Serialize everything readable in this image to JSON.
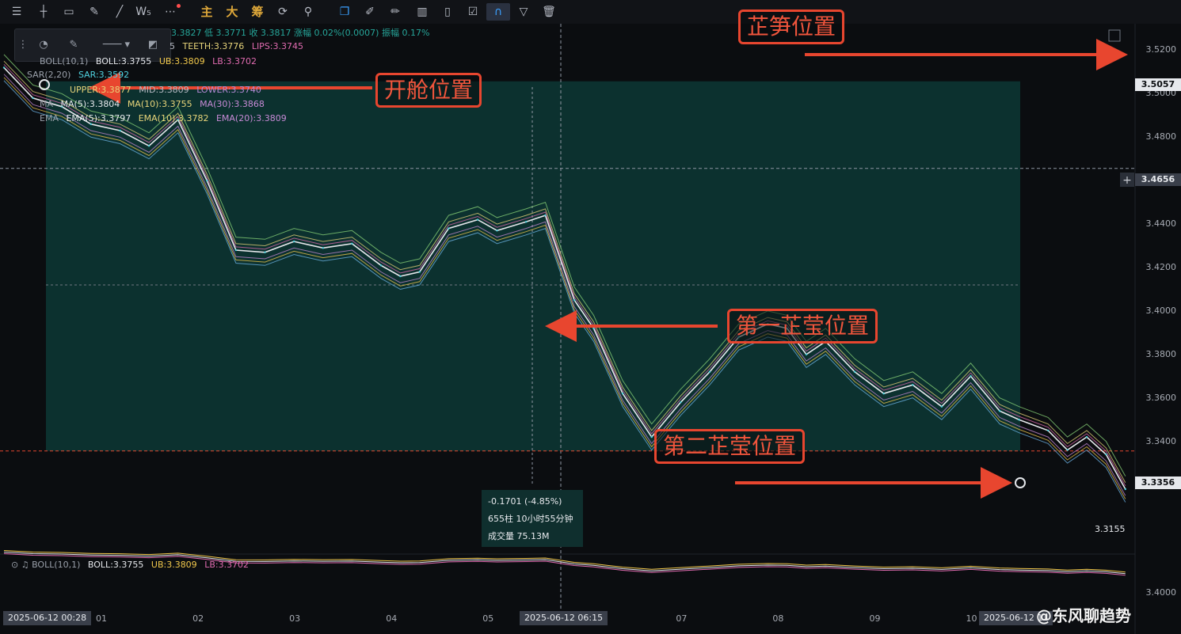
{
  "toolbar": {
    "icons": [
      "menu-icon",
      "crosshair-icon",
      "rectangle-icon",
      "ruler-icon",
      "trend-line-icon",
      "wave-icon",
      "more-icon"
    ],
    "cn_buttons": [
      "主",
      "大",
      "筹"
    ],
    "right_icons": [
      "sync-icon",
      "draw-icon",
      "copy-icon",
      "ruler2-icon",
      "brush-icon",
      "candles-icon",
      "clipboard-icon",
      "edit-icon",
      "magnet-icon",
      "filter-icon",
      "trash-icon"
    ]
  },
  "ohlc_line": "3.3827 低 3.3771 收 3.3817 涨幅 0.02%(0.0007) 振幅 0.17%",
  "alligator": {
    "prefix": "5",
    "teeth": "TEETH:3.3776",
    "lips": "LIPS:3.3745"
  },
  "boll_main": {
    "name": "BOLL(10,1)",
    "value": "BOLL:3.3755",
    "ub": "UB:3.3809",
    "lb": "LB:3.3702"
  },
  "sar": {
    "name": "SAR(2,20)",
    "value": "SAR:3.3592"
  },
  "band": {
    "upper": "UPPER:3.3877",
    "mid": "MID:3.3809",
    "lower": "LOWER:3.3740"
  },
  "ma": {
    "name": "MA",
    "ma5": "MA(5):3.3804",
    "ma10": "MA(10):3.3755",
    "ma30": "MA(30):3.3868"
  },
  "ema": {
    "name": "EMA",
    "ema5": "EMA(5):3.3797",
    "ema10": "EMA(10):3.3782",
    "ema20": "EMA(20):3.3809"
  },
  "price_tags": {
    "top": "3.5057",
    "crosshair": "3.4656",
    "bottom": "3.3356",
    "last": "3.3155"
  },
  "measure": {
    "change": "-0.1701 (-4.85%)",
    "bars": "655柱 10小时55分钟",
    "volume": "成交量 75.13M"
  },
  "callouts": {
    "target": "芷笋位置",
    "entry": "开舱位置",
    "first": "第一芷莹位置",
    "second": "第二芷莹位置"
  },
  "sub_indicator": {
    "name": "BOLL(10,1)",
    "value": "BOLL:3.3755",
    "ub": "UB:3.3809",
    "lb": "LB:3.3702",
    "axis": "3.4000"
  },
  "x_axis": {
    "start_tag": "2025-06-12 00:28",
    "mid_tag": "2025-06-12 06:15",
    "end_tag": "2025-06-12 1",
    "end_tail": "3"
  },
  "watermark": "@东风聊趋势",
  "colors": {
    "bg": "#0b0d10",
    "box": "#0e3d3a",
    "accent_red": "#e8462f",
    "up": "#26a69a",
    "down": "#ef5350"
  },
  "chart_data": {
    "type": "line",
    "title": "",
    "xlabel": "",
    "ylabel": "",
    "ylim": [
      3.31,
      3.53
    ],
    "y_ticks": [
      3.52,
      3.5,
      3.48,
      3.46,
      3.44,
      3.42,
      3.4,
      3.38,
      3.36,
      3.34,
      3.32
    ],
    "y_tick_labels": [
      "3.5200",
      "3.5000",
      "3.4800",
      "3.4600",
      "3.4400",
      "3.4200",
      "3.4000",
      "3.3800",
      "3.3600",
      "3.3400",
      "3.3200"
    ],
    "x_range": [
      0,
      11.7
    ],
    "x_ticks": [
      1,
      2,
      3,
      4,
      5,
      7,
      8,
      9,
      10
    ],
    "x_tick_labels": [
      "01",
      "02",
      "03",
      "04",
      "05",
      "07",
      "08",
      "09",
      "10"
    ],
    "series": [
      {
        "x": [
          0,
          0.3,
          0.6,
          0.9,
          1.2,
          1.5,
          1.8,
          2.1,
          2.4,
          2.7,
          3.0,
          3.3,
          3.6,
          3.9,
          4.1,
          4.3,
          4.6,
          4.9,
          5.1,
          5.4,
          5.6,
          5.9,
          6.1,
          6.4,
          6.7,
          7.0,
          7.3,
          7.6,
          7.9,
          8.1,
          8.3,
          8.5,
          8.8,
          9.1,
          9.4,
          9.7,
          10.0,
          10.3,
          10.5,
          10.8,
          11.0,
          11.2,
          11.4,
          11.6
        ],
        "values": [
          3.512,
          3.498,
          3.494,
          3.486,
          3.483,
          3.476,
          3.488,
          3.46,
          3.428,
          3.427,
          3.432,
          3.429,
          3.431,
          3.421,
          3.416,
          3.418,
          3.438,
          3.442,
          3.437,
          3.441,
          3.444,
          3.405,
          3.392,
          3.362,
          3.342,
          3.358,
          3.372,
          3.388,
          3.394,
          3.392,
          3.38,
          3.386,
          3.372,
          3.362,
          3.366,
          3.356,
          3.37,
          3.354,
          3.35,
          3.345,
          3.336,
          3.342,
          3.334,
          3.318
        ]
      }
    ],
    "levels": {
      "entry": 3.5057,
      "stop_low": 3.3356,
      "crosshair": 3.4656,
      "target": 3.52
    },
    "grid": false
  }
}
